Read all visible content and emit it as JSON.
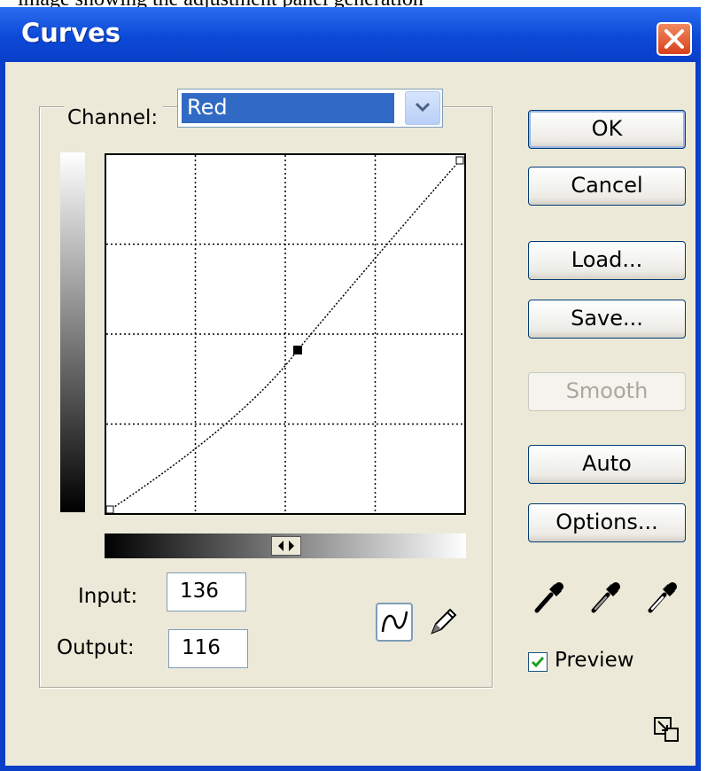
{
  "caption": "image showing the adjustment panel generation",
  "window": {
    "title": "Curves",
    "close_label": "Close"
  },
  "channel": {
    "label": "Channel:",
    "value": "Red"
  },
  "curve": {
    "input_label": "Input:",
    "input_value": "136",
    "output_label": "Output:",
    "output_value": "116"
  },
  "buttons": {
    "ok": "OK",
    "cancel": "Cancel",
    "load": "Load...",
    "save": "Save...",
    "smooth": "Smooth",
    "auto": "Auto",
    "options": "Options..."
  },
  "preview": {
    "label": "Preview",
    "checked": true
  },
  "colors": {
    "titlebar": "#0a3fc8",
    "dialog_bg": "#ece9d8",
    "selection": "#316ac5",
    "close_button": "#d8401a",
    "checkmark": "#21a121"
  },
  "icons": [
    "close-icon",
    "dropdown-arrow-icon",
    "curve-tool-icon",
    "pencil-icon",
    "black-eyedropper-icon",
    "gray-eyedropper-icon",
    "white-eyedropper-icon",
    "expand-icon"
  ]
}
